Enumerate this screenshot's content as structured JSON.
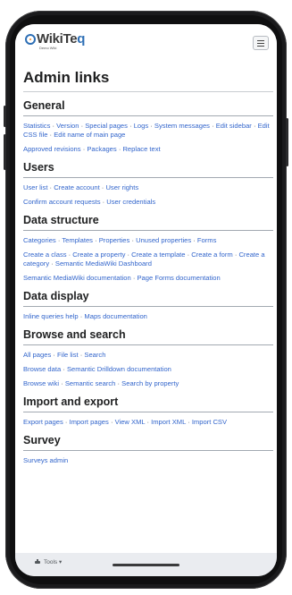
{
  "header": {
    "logo_main": "WikiTe",
    "logo_q": "q",
    "logo_sub": "Demo Wiki"
  },
  "page": {
    "title": "Admin links"
  },
  "sections": [
    {
      "title": "General",
      "paras": [
        [
          "Statistics",
          "Version",
          "Special pages",
          "Logs",
          "System messages",
          "Edit sidebar",
          "Edit CSS file",
          "Edit name of main page"
        ],
        [
          "Approved revisions",
          "Packages",
          "Replace text"
        ]
      ]
    },
    {
      "title": "Users",
      "paras": [
        [
          "User list",
          "Create account",
          "User rights"
        ],
        [
          "Confirm account requests",
          "User credentials"
        ]
      ]
    },
    {
      "title": "Data structure",
      "paras": [
        [
          "Categories",
          "Templates",
          "Properties",
          "Unused properties",
          "Forms"
        ],
        [
          "Create a class",
          "Create a property",
          "Create a template",
          "Create a form",
          "Create a category",
          "Semantic MediaWiki Dashboard"
        ],
        [
          "Semantic MediaWiki documentation",
          "Page Forms documentation"
        ]
      ]
    },
    {
      "title": "Data display",
      "paras": [
        [
          "Inline queries help",
          "Maps documentation"
        ]
      ]
    },
    {
      "title": "Browse and search",
      "paras": [
        [
          "All pages",
          "File list",
          "Search"
        ],
        [
          "Browse data",
          "Semantic Drilldown documentation"
        ],
        [
          "Browse wiki",
          "Semantic search",
          "Search by property"
        ]
      ]
    },
    {
      "title": "Import and export",
      "paras": [
        [
          "Export pages",
          "Import pages",
          "View XML",
          "Import XML",
          "Import CSV"
        ]
      ]
    },
    {
      "title": "Survey",
      "paras": [
        [
          "Surveys admin"
        ]
      ]
    }
  ],
  "footer": {
    "tools_label": "Tools ▾"
  },
  "colors": {
    "link": "#3366cc",
    "text": "#202122",
    "footer_bg": "#eaecf0"
  },
  "icons": {
    "menu": "hamburger-menu-icon",
    "tools": "tools-icon"
  }
}
